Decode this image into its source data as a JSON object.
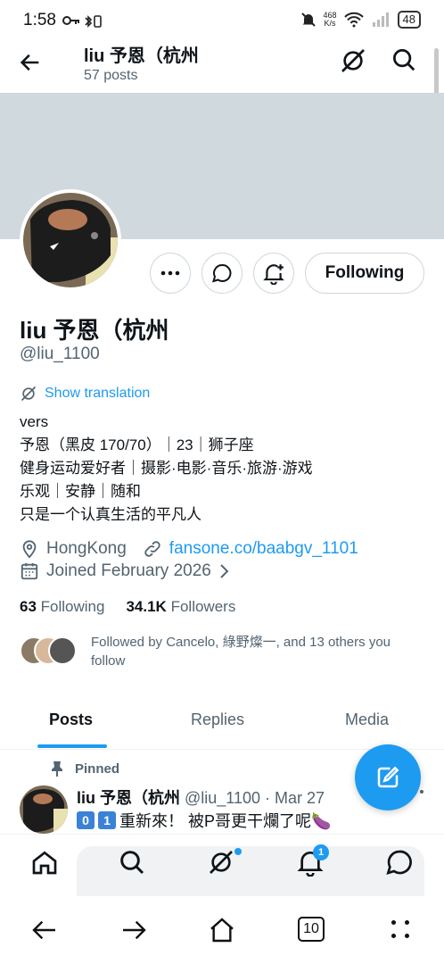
{
  "status": {
    "time": "1:58",
    "speed_value": "468",
    "speed_unit": "K/s",
    "battery": "48"
  },
  "header": {
    "name": "liu 予恩（杭州",
    "posts": "57 posts"
  },
  "profile": {
    "name": "liu 予恩（杭州",
    "handle": "@liu_1100",
    "show_translation": "Show translation",
    "bio": [
      "vers",
      "予恩（黑皮 170/70）｜23｜狮子座",
      "健身运动爱好者｜摄影·电影·音乐·旅游·游戏",
      "乐观｜安静｜随和",
      "只是一个认真生活的平凡人"
    ],
    "location": "HongKong",
    "website": "fansone.co/baabgv_1101",
    "joined": "Joined February 2026",
    "following_count": "63",
    "following_label": "Following",
    "followers_count": "34.1K",
    "followers_label": "Followers",
    "followed_by": "Followed by Cancelo, 綠野燦一, and 13 others you follow"
  },
  "actions": {
    "following_button": "Following"
  },
  "tabs": [
    "Posts",
    "Replies",
    "Media"
  ],
  "pinned_post": {
    "pinned_label": "Pinned",
    "author": "liu 予恩（杭州",
    "handle_date": "@liu_1100 · Mar 27",
    "num1": "0",
    "num2": "1",
    "text": "重新來！ 被P哥更干爛了呢🍆"
  },
  "nav": {
    "notification_badge": "1"
  },
  "browser": {
    "tab_count": "10"
  },
  "colors": {
    "accent": "#1d9bf0",
    "banner": "#cfd9de",
    "secondary_text": "#536471"
  }
}
